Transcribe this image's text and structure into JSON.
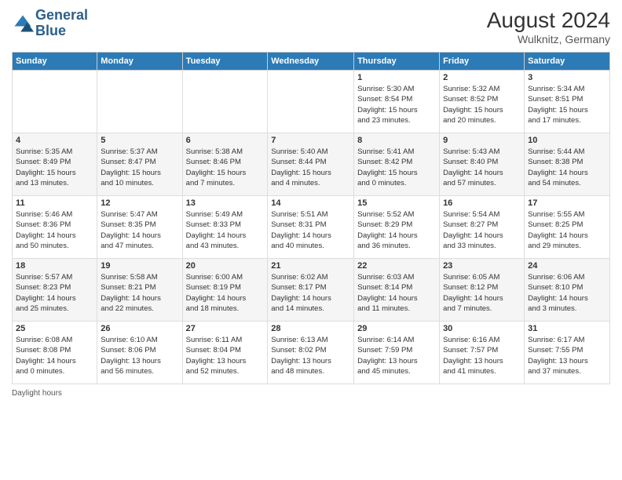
{
  "header": {
    "logo_line1": "General",
    "logo_line2": "Blue",
    "month_year": "August 2024",
    "location": "Wulknitz, Germany"
  },
  "footer": {
    "daylight_label": "Daylight hours"
  },
  "columns": [
    "Sunday",
    "Monday",
    "Tuesday",
    "Wednesday",
    "Thursday",
    "Friday",
    "Saturday"
  ],
  "weeks": [
    [
      {
        "day": "",
        "info": ""
      },
      {
        "day": "",
        "info": ""
      },
      {
        "day": "",
        "info": ""
      },
      {
        "day": "",
        "info": ""
      },
      {
        "day": "1",
        "info": "Sunrise: 5:30 AM\nSunset: 8:54 PM\nDaylight: 15 hours\nand 23 minutes."
      },
      {
        "day": "2",
        "info": "Sunrise: 5:32 AM\nSunset: 8:52 PM\nDaylight: 15 hours\nand 20 minutes."
      },
      {
        "day": "3",
        "info": "Sunrise: 5:34 AM\nSunset: 8:51 PM\nDaylight: 15 hours\nand 17 minutes."
      }
    ],
    [
      {
        "day": "4",
        "info": "Sunrise: 5:35 AM\nSunset: 8:49 PM\nDaylight: 15 hours\nand 13 minutes."
      },
      {
        "day": "5",
        "info": "Sunrise: 5:37 AM\nSunset: 8:47 PM\nDaylight: 15 hours\nand 10 minutes."
      },
      {
        "day": "6",
        "info": "Sunrise: 5:38 AM\nSunset: 8:46 PM\nDaylight: 15 hours\nand 7 minutes."
      },
      {
        "day": "7",
        "info": "Sunrise: 5:40 AM\nSunset: 8:44 PM\nDaylight: 15 hours\nand 4 minutes."
      },
      {
        "day": "8",
        "info": "Sunrise: 5:41 AM\nSunset: 8:42 PM\nDaylight: 15 hours\nand 0 minutes."
      },
      {
        "day": "9",
        "info": "Sunrise: 5:43 AM\nSunset: 8:40 PM\nDaylight: 14 hours\nand 57 minutes."
      },
      {
        "day": "10",
        "info": "Sunrise: 5:44 AM\nSunset: 8:38 PM\nDaylight: 14 hours\nand 54 minutes."
      }
    ],
    [
      {
        "day": "11",
        "info": "Sunrise: 5:46 AM\nSunset: 8:36 PM\nDaylight: 14 hours\nand 50 minutes."
      },
      {
        "day": "12",
        "info": "Sunrise: 5:47 AM\nSunset: 8:35 PM\nDaylight: 14 hours\nand 47 minutes."
      },
      {
        "day": "13",
        "info": "Sunrise: 5:49 AM\nSunset: 8:33 PM\nDaylight: 14 hours\nand 43 minutes."
      },
      {
        "day": "14",
        "info": "Sunrise: 5:51 AM\nSunset: 8:31 PM\nDaylight: 14 hours\nand 40 minutes."
      },
      {
        "day": "15",
        "info": "Sunrise: 5:52 AM\nSunset: 8:29 PM\nDaylight: 14 hours\nand 36 minutes."
      },
      {
        "day": "16",
        "info": "Sunrise: 5:54 AM\nSunset: 8:27 PM\nDaylight: 14 hours\nand 33 minutes."
      },
      {
        "day": "17",
        "info": "Sunrise: 5:55 AM\nSunset: 8:25 PM\nDaylight: 14 hours\nand 29 minutes."
      }
    ],
    [
      {
        "day": "18",
        "info": "Sunrise: 5:57 AM\nSunset: 8:23 PM\nDaylight: 14 hours\nand 25 minutes."
      },
      {
        "day": "19",
        "info": "Sunrise: 5:58 AM\nSunset: 8:21 PM\nDaylight: 14 hours\nand 22 minutes."
      },
      {
        "day": "20",
        "info": "Sunrise: 6:00 AM\nSunset: 8:19 PM\nDaylight: 14 hours\nand 18 minutes."
      },
      {
        "day": "21",
        "info": "Sunrise: 6:02 AM\nSunset: 8:17 PM\nDaylight: 14 hours\nand 14 minutes."
      },
      {
        "day": "22",
        "info": "Sunrise: 6:03 AM\nSunset: 8:14 PM\nDaylight: 14 hours\nand 11 minutes."
      },
      {
        "day": "23",
        "info": "Sunrise: 6:05 AM\nSunset: 8:12 PM\nDaylight: 14 hours\nand 7 minutes."
      },
      {
        "day": "24",
        "info": "Sunrise: 6:06 AM\nSunset: 8:10 PM\nDaylight: 14 hours\nand 3 minutes."
      }
    ],
    [
      {
        "day": "25",
        "info": "Sunrise: 6:08 AM\nSunset: 8:08 PM\nDaylight: 14 hours\nand 0 minutes."
      },
      {
        "day": "26",
        "info": "Sunrise: 6:10 AM\nSunset: 8:06 PM\nDaylight: 13 hours\nand 56 minutes."
      },
      {
        "day": "27",
        "info": "Sunrise: 6:11 AM\nSunset: 8:04 PM\nDaylight: 13 hours\nand 52 minutes."
      },
      {
        "day": "28",
        "info": "Sunrise: 6:13 AM\nSunset: 8:02 PM\nDaylight: 13 hours\nand 48 minutes."
      },
      {
        "day": "29",
        "info": "Sunrise: 6:14 AM\nSunset: 7:59 PM\nDaylight: 13 hours\nand 45 minutes."
      },
      {
        "day": "30",
        "info": "Sunrise: 6:16 AM\nSunset: 7:57 PM\nDaylight: 13 hours\nand 41 minutes."
      },
      {
        "day": "31",
        "info": "Sunrise: 6:17 AM\nSunset: 7:55 PM\nDaylight: 13 hours\nand 37 minutes."
      }
    ]
  ]
}
